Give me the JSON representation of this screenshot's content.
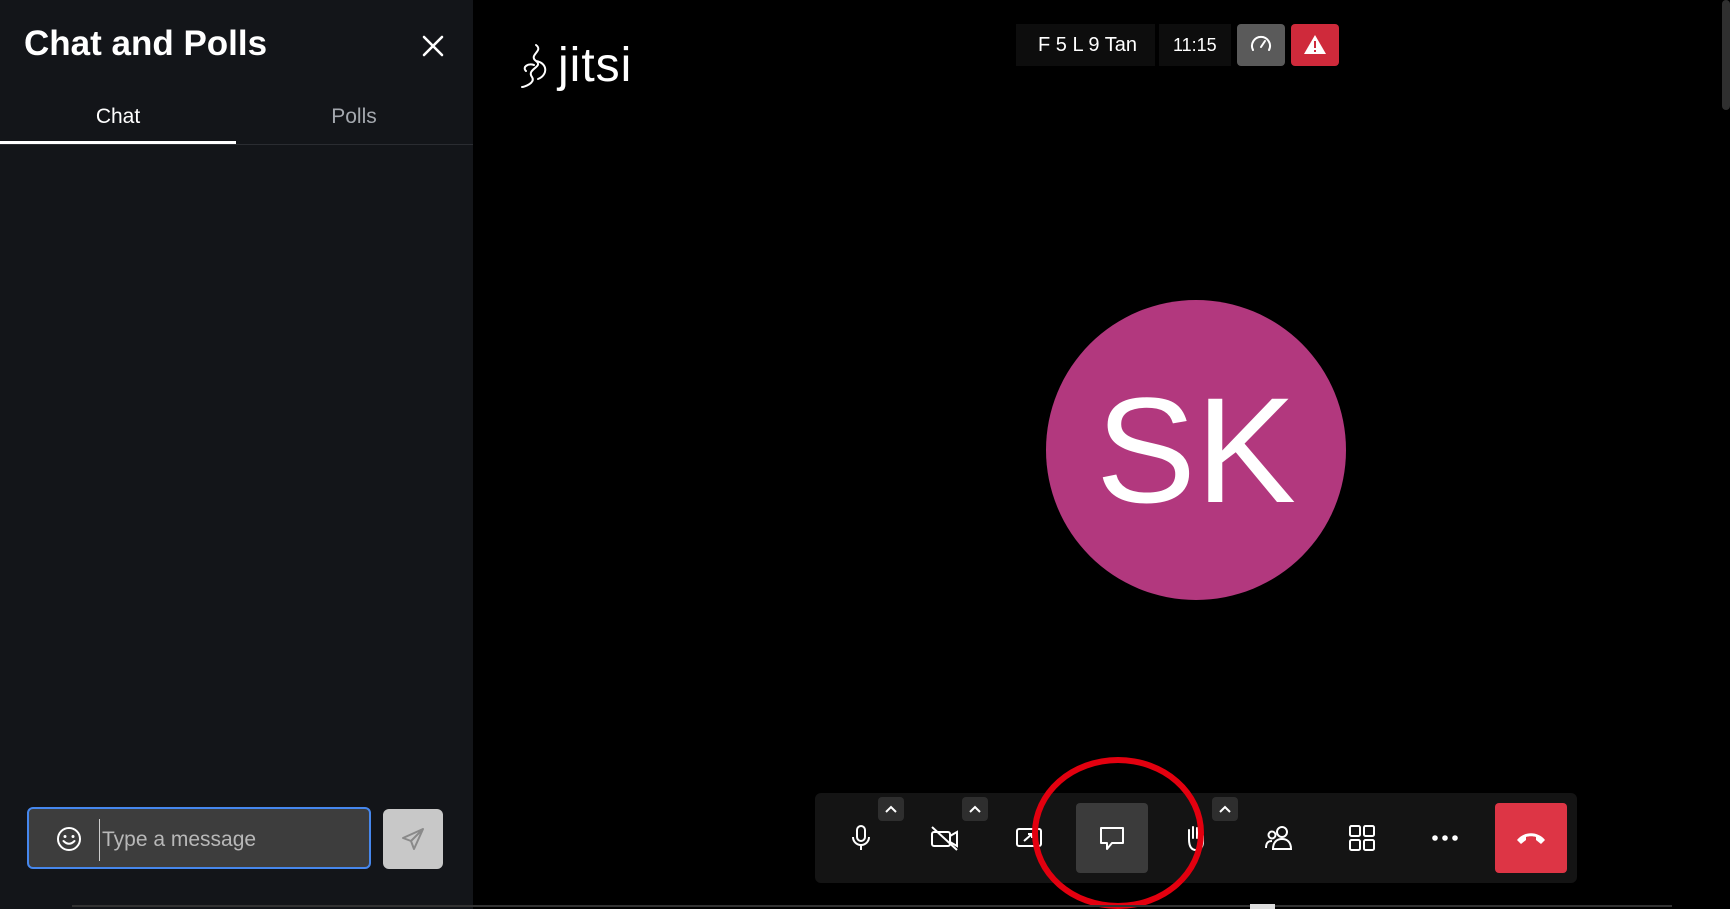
{
  "sidebar": {
    "title": "Chat and Polls",
    "tabs": [
      {
        "label": "Chat",
        "active": true
      },
      {
        "label": "Polls",
        "active": false
      }
    ],
    "composer": {
      "placeholder": "Type a message",
      "value": ""
    }
  },
  "header": {
    "logo_text": "jitsi",
    "conference_name": "F 5 L 9 Tan",
    "conference_time": "11:15"
  },
  "stage": {
    "avatar_initials": "SK",
    "avatar_color": "#b2387e"
  },
  "toolbar": {
    "buttons": [
      {
        "name": "microphone",
        "icon": "microphone-icon"
      },
      {
        "name": "camera",
        "icon": "camera-off-icon"
      },
      {
        "name": "share-screen",
        "icon": "screen-share-icon"
      },
      {
        "name": "chat",
        "icon": "chat-icon",
        "active": true
      },
      {
        "name": "raise-hand",
        "icon": "raise-hand-icon"
      },
      {
        "name": "participants",
        "icon": "participants-icon"
      },
      {
        "name": "tile-view",
        "icon": "tile-view-icon"
      },
      {
        "name": "more",
        "icon": "more-icon"
      },
      {
        "name": "hangup",
        "icon": "hangup-icon"
      }
    ]
  },
  "colors": {
    "accent_blue": "#4687ed",
    "danger_red": "#dd3545",
    "annotation_red": "#e3000f"
  }
}
